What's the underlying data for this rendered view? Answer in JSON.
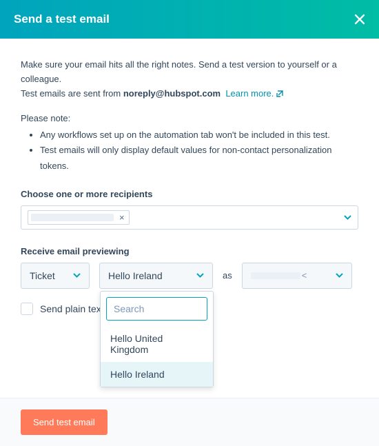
{
  "header": {
    "title": "Send a test email"
  },
  "intro": {
    "line1": "Make sure your email hits all the right notes. Send a test version to yourself or a colleague.",
    "line2_prefix": "Test emails are sent from ",
    "sender": "noreply@hubspot.com",
    "learn_more": "Learn more."
  },
  "notes": {
    "please_note": "Please note:",
    "items": [
      "Any workflows set up on the automation tab won't be included in this test.",
      "Test emails will only display default values for non-contact personalization tokens."
    ]
  },
  "recipients": {
    "label": "Choose one or more recipients",
    "chip_remove": "×"
  },
  "preview": {
    "label": "Receive email previewing",
    "type": "Ticket",
    "selected": "Hello Ireland",
    "as": "as",
    "angle": "<",
    "search_placeholder": "Search",
    "options": [
      "Hello United Kingdom",
      "Hello Ireland"
    ]
  },
  "plaintext": {
    "label": "Send plain text only"
  },
  "footer": {
    "send": "Send test email"
  },
  "colors": {
    "accent": "#00a4bd",
    "primary_btn": "#ff7a59"
  }
}
